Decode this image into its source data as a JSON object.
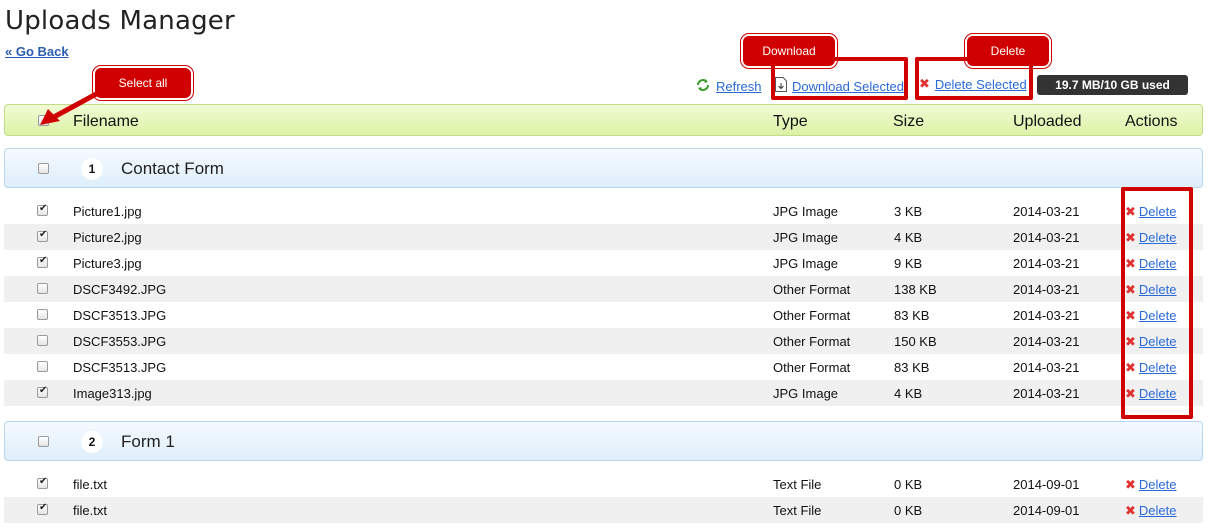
{
  "page": {
    "title": "Uploads Manager",
    "back_link": "« Go Back"
  },
  "toolbar": {
    "refresh": "Refresh",
    "download_selected": "Download Selected",
    "delete_selected": "Delete Selected",
    "storage": "19.7 MB/10 GB used"
  },
  "table": {
    "headers": {
      "filename": "Filename",
      "type": "Type",
      "size": "Size",
      "uploaded": "Uploaded",
      "actions": "Actions"
    }
  },
  "groups": [
    {
      "number": "1",
      "name": "Contact Form",
      "files": [
        {
          "name": "Picture1.jpg",
          "type": "JPG Image",
          "size": "3 KB",
          "date": "2014-03-21",
          "checked": true,
          "action": "Delete"
        },
        {
          "name": "Picture2.jpg",
          "type": "JPG Image",
          "size": "4 KB",
          "date": "2014-03-21",
          "checked": true,
          "action": "Delete"
        },
        {
          "name": "Picture3.jpg",
          "type": "JPG Image",
          "size": "9 KB",
          "date": "2014-03-21",
          "checked": true,
          "action": "Delete"
        },
        {
          "name": "DSCF3492.JPG",
          "type": "Other Format",
          "size": "138 KB",
          "date": "2014-03-21",
          "checked": false,
          "action": "Delete"
        },
        {
          "name": "DSCF3513.JPG",
          "type": "Other Format",
          "size": "83 KB",
          "date": "2014-03-21",
          "checked": false,
          "action": "Delete"
        },
        {
          "name": "DSCF3553.JPG",
          "type": "Other Format",
          "size": "150 KB",
          "date": "2014-03-21",
          "checked": false,
          "action": "Delete"
        },
        {
          "name": "DSCF3513.JPG",
          "type": "Other Format",
          "size": "83 KB",
          "date": "2014-03-21",
          "checked": false,
          "action": "Delete"
        },
        {
          "name": "Image313.jpg",
          "type": "JPG Image",
          "size": "4 KB",
          "date": "2014-03-21",
          "checked": true,
          "action": "Delete"
        }
      ]
    },
    {
      "number": "2",
      "name": "Form 1",
      "files": [
        {
          "name": "file.txt",
          "type": "Text File",
          "size": "0 KB",
          "date": "2014-09-01",
          "checked": true,
          "action": "Delete"
        },
        {
          "name": "file.txt",
          "type": "Text File",
          "size": "0 KB",
          "date": "2014-09-01",
          "checked": true,
          "action": "Delete"
        }
      ]
    }
  ],
  "annotations": {
    "select_all": "Select all",
    "download": "Download",
    "delete": "Delete"
  },
  "colors": {
    "accent_link": "#2a6ad8",
    "annotation_red": "#d10000",
    "header_green": "#dcf2a6",
    "group_blue": "#deeefb",
    "storage_badge": "#333333"
  }
}
